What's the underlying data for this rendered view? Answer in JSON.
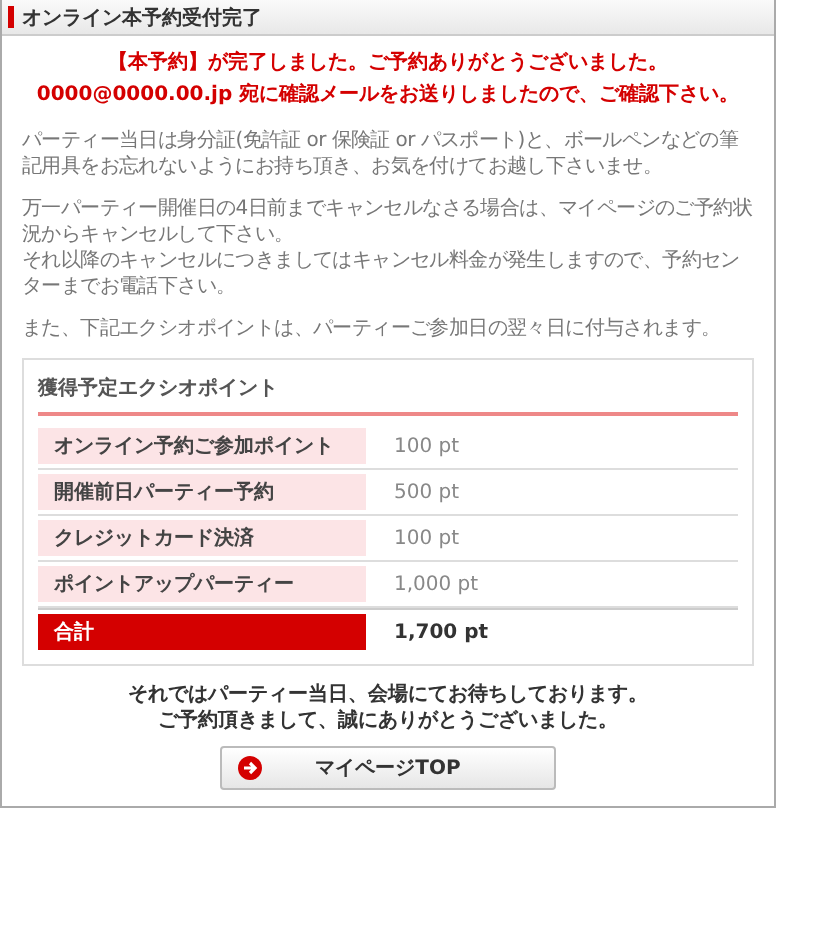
{
  "title": "オンライン本予約受付完了",
  "headline": [
    "【本予約】が完了しました。ご予約ありがとうございました。",
    "0000@0000.00.jp 宛に確認メールをお送りしましたので、ご確認下さい。"
  ],
  "paragraphs": [
    [
      "パーティー当日は身分証(免許証 or 保険証 or パスポート)と、ボールペンなどの筆記用具をお忘れないようにお持ち頂き、お気を付けてお越し下さいませ。"
    ],
    [
      "万一パーティー開催日の4日前までキャンセルなさる場合は、マイページのご予約状況からキャンセルして下さい。",
      "それ以降のキャンセルにつきましてはキャンセル料金が発生しますので、予約センターまでお電話下さい。"
    ],
    [
      "また、下記エクシオポイントは、パーティーご参加日の翌々日に付与されます。"
    ]
  ],
  "points": {
    "heading": "獲得予定エクシオポイント",
    "rows": [
      {
        "kind": "item",
        "label": "オンライン予約ご参加ポイント",
        "value": "100 pt"
      },
      {
        "kind": "item",
        "label": "開催前日パーティー予約",
        "value": "500 pt"
      },
      {
        "kind": "item",
        "label": "クレジットカード決済",
        "value": "100 pt"
      },
      {
        "kind": "item",
        "label": "ポイントアップパーティー",
        "value": "1,000 pt"
      },
      {
        "kind": "total",
        "label": "合計",
        "value": "1,700 pt"
      }
    ]
  },
  "closing": [
    "それではパーティー当日、会場にてお待ちしております。",
    "ご予約頂きまして、誠にありがとうございました。"
  ],
  "button": {
    "label": "マイページTOP"
  }
}
